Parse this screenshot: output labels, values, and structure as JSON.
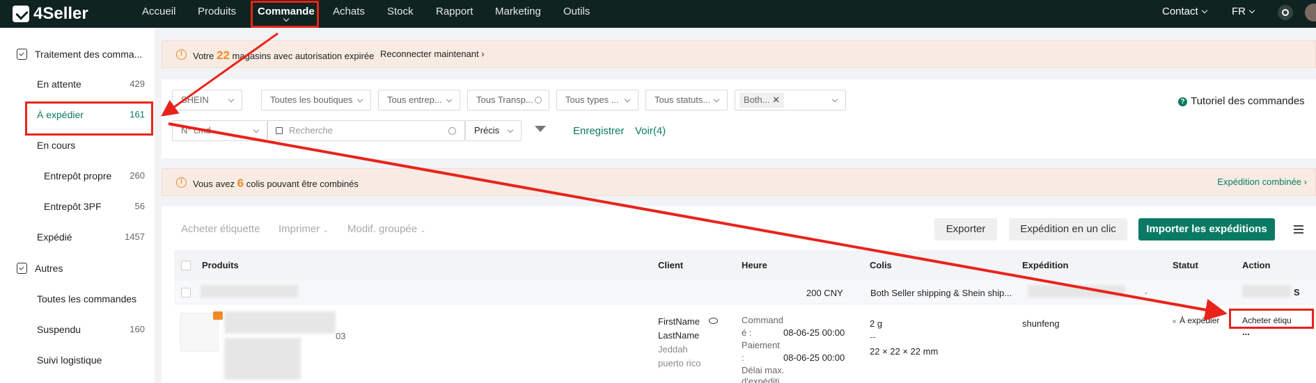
{
  "brand": {
    "name": "4Seller"
  },
  "nav": {
    "items": [
      "Accueil",
      "Produits",
      "Commande",
      "Achats",
      "Stock",
      "Rapport",
      "Marketing",
      "Outils"
    ],
    "contact": "Contact",
    "lang": "FR"
  },
  "sidebar": {
    "group1": "Traitement des comma...",
    "pending": {
      "label": "En attente",
      "count": "429"
    },
    "to_ship": {
      "label": "À expédier",
      "count": "161"
    },
    "in_progress": {
      "label": "En cours"
    },
    "own_wh": {
      "label": "Entrepôt propre",
      "count": "260"
    },
    "wh_3pf": {
      "label": "Entrepôt 3PF",
      "count": "56"
    },
    "shipped": {
      "label": "Expédié",
      "count": "1457"
    },
    "group2": "Autres",
    "all_orders": {
      "label": "Toutes les commandes"
    },
    "suspended": {
      "label": "Suspendu",
      "count": "160"
    },
    "tracking": {
      "label": "Suivi logistique"
    }
  },
  "alert1": {
    "pre": "Votre",
    "num": "22",
    "post": "magasins avec autorisation expirée",
    "action": "Reconnecter maintenant"
  },
  "filters": {
    "platform": "SHEIN",
    "shops": "Toutes les boutiques",
    "warehouses": "Tous entrep...",
    "carriers": "Tous Transp...",
    "types": "Tous types ...",
    "statuses": "Tous statuts...",
    "both_tag": "Both...",
    "tutorial": "Tutoriel des commandes",
    "order_no": "N° cmd",
    "search_placeholder": "Recherche",
    "precise": "Précis",
    "save": "Enregistrer",
    "view": "Voir(4)"
  },
  "alert2": {
    "pre": "Vous avez",
    "num": "6",
    "post": "colis pouvant être combinés",
    "action": "Expédition combinée"
  },
  "toolbar": {
    "buy_label": "Acheter étiquette",
    "print": "Imprimer",
    "bulk_edit": "Modif. groupée",
    "export": "Exporter",
    "one_click": "Expédition en un clic",
    "import": "Importer les expéditions"
  },
  "table": {
    "headers": [
      "Produits",
      "Client",
      "Heure",
      "Colis",
      "Expédition",
      "Statut",
      "Action"
    ],
    "group_row": {
      "amount": "200 CNY",
      "shipping": "Both Seller shipping & Shein ship...",
      "suffix": "S"
    },
    "row": {
      "sku_suffix": "03",
      "client_first": "FirstName",
      "client_last": "LastName",
      "city": "Jeddah",
      "region": "puerto rico",
      "order_label_1": "Command",
      "order_label_2": "é :",
      "order_time": "08-06-25 00:00",
      "pay_label_1": "Paiement",
      "pay_label_2": ":",
      "pay_time": "08-06-25 00:00",
      "deadline_1": "Délai max.",
      "deadline_2": "d'expéditi",
      "weight": "2 g",
      "dash": "--",
      "dims": "22 × 22 × 22 mm",
      "carrier": "shunfeng",
      "status": "À expédier",
      "action": "Acheter étiqu",
      "more": "..."
    }
  },
  "colors": {
    "brand_green": "#0a7a64",
    "nav_bg": "#0f2320",
    "annotation_red": "#e8231b",
    "warning_orange": "#f08a24"
  }
}
